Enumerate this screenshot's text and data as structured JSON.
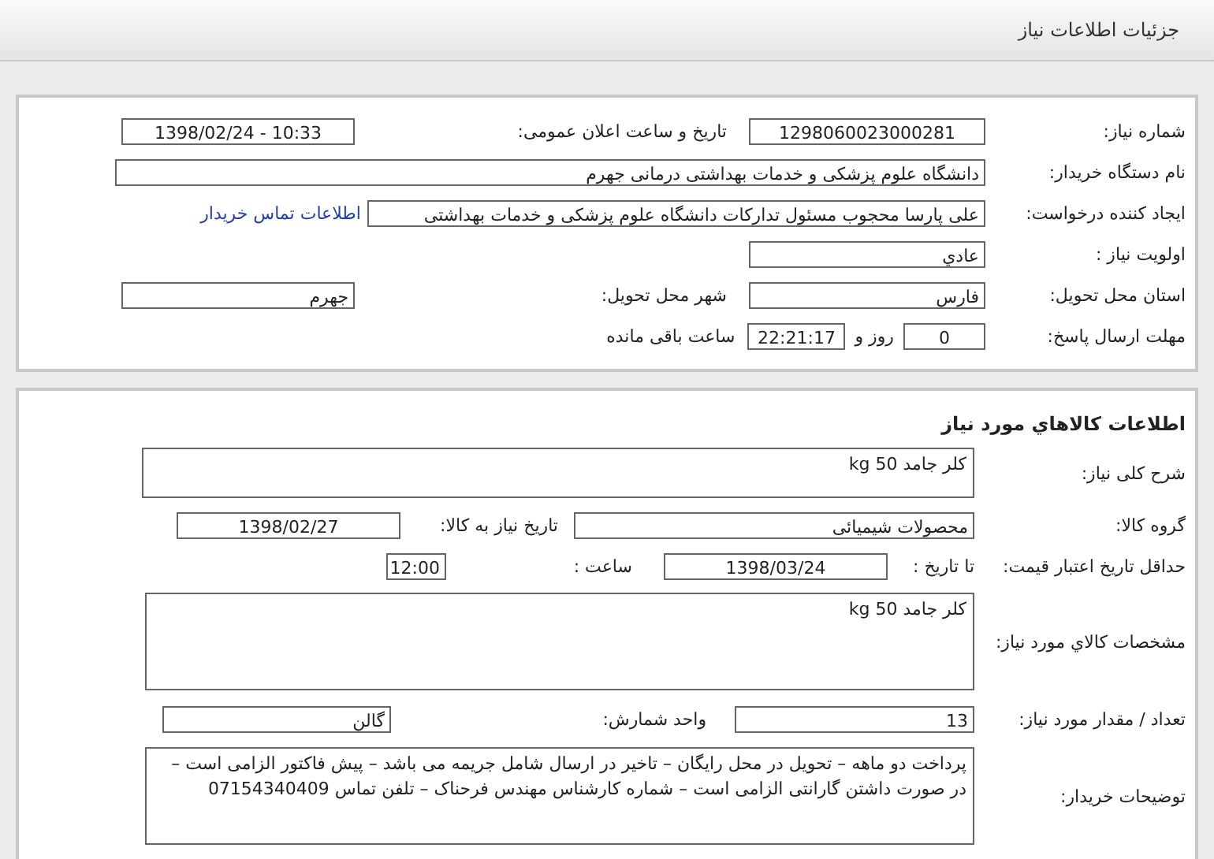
{
  "page_title": "جزئیات اطلاعات نیاز",
  "request": {
    "need_number": {
      "label": "شماره نیاز:",
      "value": "1298060023000281"
    },
    "announce": {
      "label": "تاریخ و ساعت اعلان عمومی:",
      "value": "1398/02/24 - 10:33"
    },
    "buyer": {
      "label": "نام دستگاه خریدار:",
      "value": "دانشگاه علوم پزشکی و خدمات بهداشتی درمانی جهرم"
    },
    "creator": {
      "label": "ایجاد کننده درخواست:",
      "value": "علی پارسا محجوب مسئول تدارکات دانشگاه علوم پزشکی و خدمات بهداشتی",
      "link": "اطلاعات تماس خریدار"
    },
    "priority": {
      "label": "اولویت نیاز :",
      "value": "عادي"
    },
    "province": {
      "label": "استان محل تحویل:",
      "value": "فارس"
    },
    "city": {
      "label": "شهر محل تحویل:",
      "value": "جهرم"
    },
    "deadline": {
      "label": "مهلت ارسال پاسخ:",
      "days": "0",
      "days_text": "روز و",
      "time": "22:21:17",
      "time_text": "ساعت باقی مانده"
    }
  },
  "items": {
    "title": "اطلاعات كالاهاي مورد نياز",
    "summary": {
      "label": "شرح کلی نیاز:",
      "value": "کلر جامد 50 kg"
    },
    "group": {
      "label": "گروه کالا:",
      "value": "محصولات شیمیائی"
    },
    "need_date": {
      "label": "تاریخ نیاز به کالا:",
      "value": "1398/02/27"
    },
    "validity": {
      "label": "حداقل تاریخ اعتبار قیمت:",
      "to_label": "تا تاریخ :",
      "date": "1398/03/24",
      "time_label": "ساعت :",
      "time": "12:00"
    },
    "specs": {
      "label": "مشخصات کالاي مورد نیاز:",
      "value": "کلر جامد 50 kg"
    },
    "quantity": {
      "label": "تعداد / مقدار مورد نیاز:",
      "value": "13"
    },
    "unit": {
      "label": "واحد شمارش:",
      "value": "گالن"
    },
    "notes": {
      "label": "توضیحات خریدار:",
      "value": "پرداخت دو ماهه – تحویل در محل رایگان – تاخیر در ارسال شامل جریمه می باشد – پیش فاکتور الزامی است – در صورت داشتن گارانتی الزامی است – شماره کارشناس مهندس فرحناک – تلفن تماس 07154340409"
    }
  }
}
